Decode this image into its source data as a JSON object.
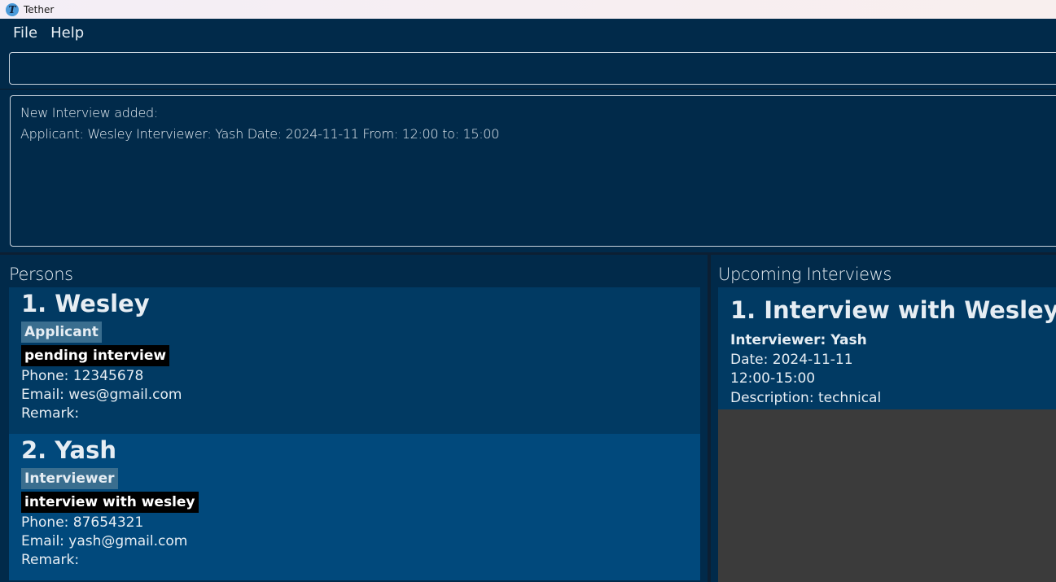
{
  "window": {
    "title": "Tether",
    "icon_letter": "T"
  },
  "menu": {
    "items": [
      "File",
      "Help"
    ]
  },
  "command_box": {
    "value": ""
  },
  "result_display": {
    "lines": [
      "New Interview added:",
      "Applicant: Wesley Interviewer: Yash Date: 2024-11-11 From: 12:00 to: 15:00"
    ]
  },
  "persons": {
    "title": "Persons",
    "list": [
      {
        "index": "1.",
        "name": "Wesley",
        "role": "Applicant",
        "status": "pending interview",
        "phone": "Phone: 12345678",
        "email": "Email: wes@gmail.com",
        "remark": "Remark:"
      },
      {
        "index": "2.",
        "name": "Yash",
        "role": "Interviewer",
        "status": "interview with wesley",
        "phone": "Phone: 87654321",
        "email": "Email: yash@gmail.com",
        "remark": "Remark:"
      }
    ]
  },
  "interviews": {
    "title": "Upcoming Interviews",
    "list": [
      {
        "index": "1.",
        "title": "Interview with Wesley",
        "interviewer": "Interviewer: Yash",
        "date": "Date: 2024-11-11",
        "time": "12:00-15:00",
        "description": "Description: technical"
      }
    ]
  },
  "colors": {
    "background": "#012a4a",
    "card_odd": "#013a63",
    "card_even": "#01497c",
    "role_tag": "#3a6e8f",
    "status_tag": "#000000",
    "empty_area": "#3b3b3b"
  }
}
